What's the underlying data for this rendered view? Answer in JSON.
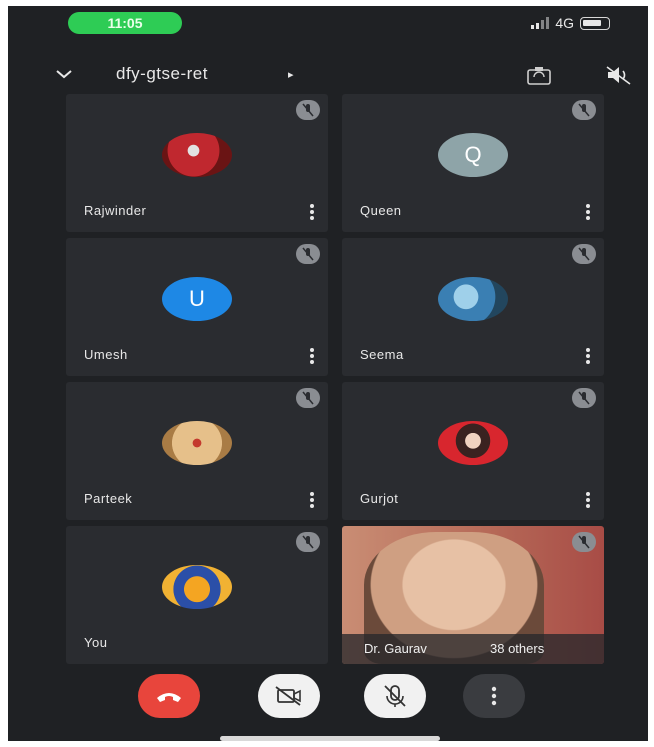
{
  "status_bar": {
    "time": "11:05",
    "network": "4G"
  },
  "header": {
    "meeting_code": "dfy-gtse-ret",
    "caret": "▸"
  },
  "colors": {
    "background": "#1f2124",
    "tile": "#2a2c30",
    "hangup": "#e8453c",
    "status_green": "#2ecc55"
  },
  "participants": [
    {
      "name": "Rajwinder",
      "avatar_type": "photo"
    },
    {
      "name": "Queen",
      "avatar_type": "letter",
      "letter": "Q",
      "color": "#8ea4a8"
    },
    {
      "name": "Umesh",
      "avatar_type": "letter",
      "letter": "U",
      "color": "#1e88e5"
    },
    {
      "name": "Seema",
      "avatar_type": "photo"
    },
    {
      "name": "Parteek",
      "avatar_type": "photo"
    },
    {
      "name": "Gurjot",
      "avatar_type": "photo"
    },
    {
      "name": "You",
      "avatar_type": "photo"
    },
    {
      "name": "Dr. Gaurav",
      "avatar_type": "video",
      "others_label": "38 others"
    }
  ],
  "controls": {
    "hangup_icon": "phone-hangup-icon",
    "camera_icon": "camera-off-icon",
    "mic_icon": "mic-off-icon",
    "more_icon": "more-vertical-icon"
  }
}
